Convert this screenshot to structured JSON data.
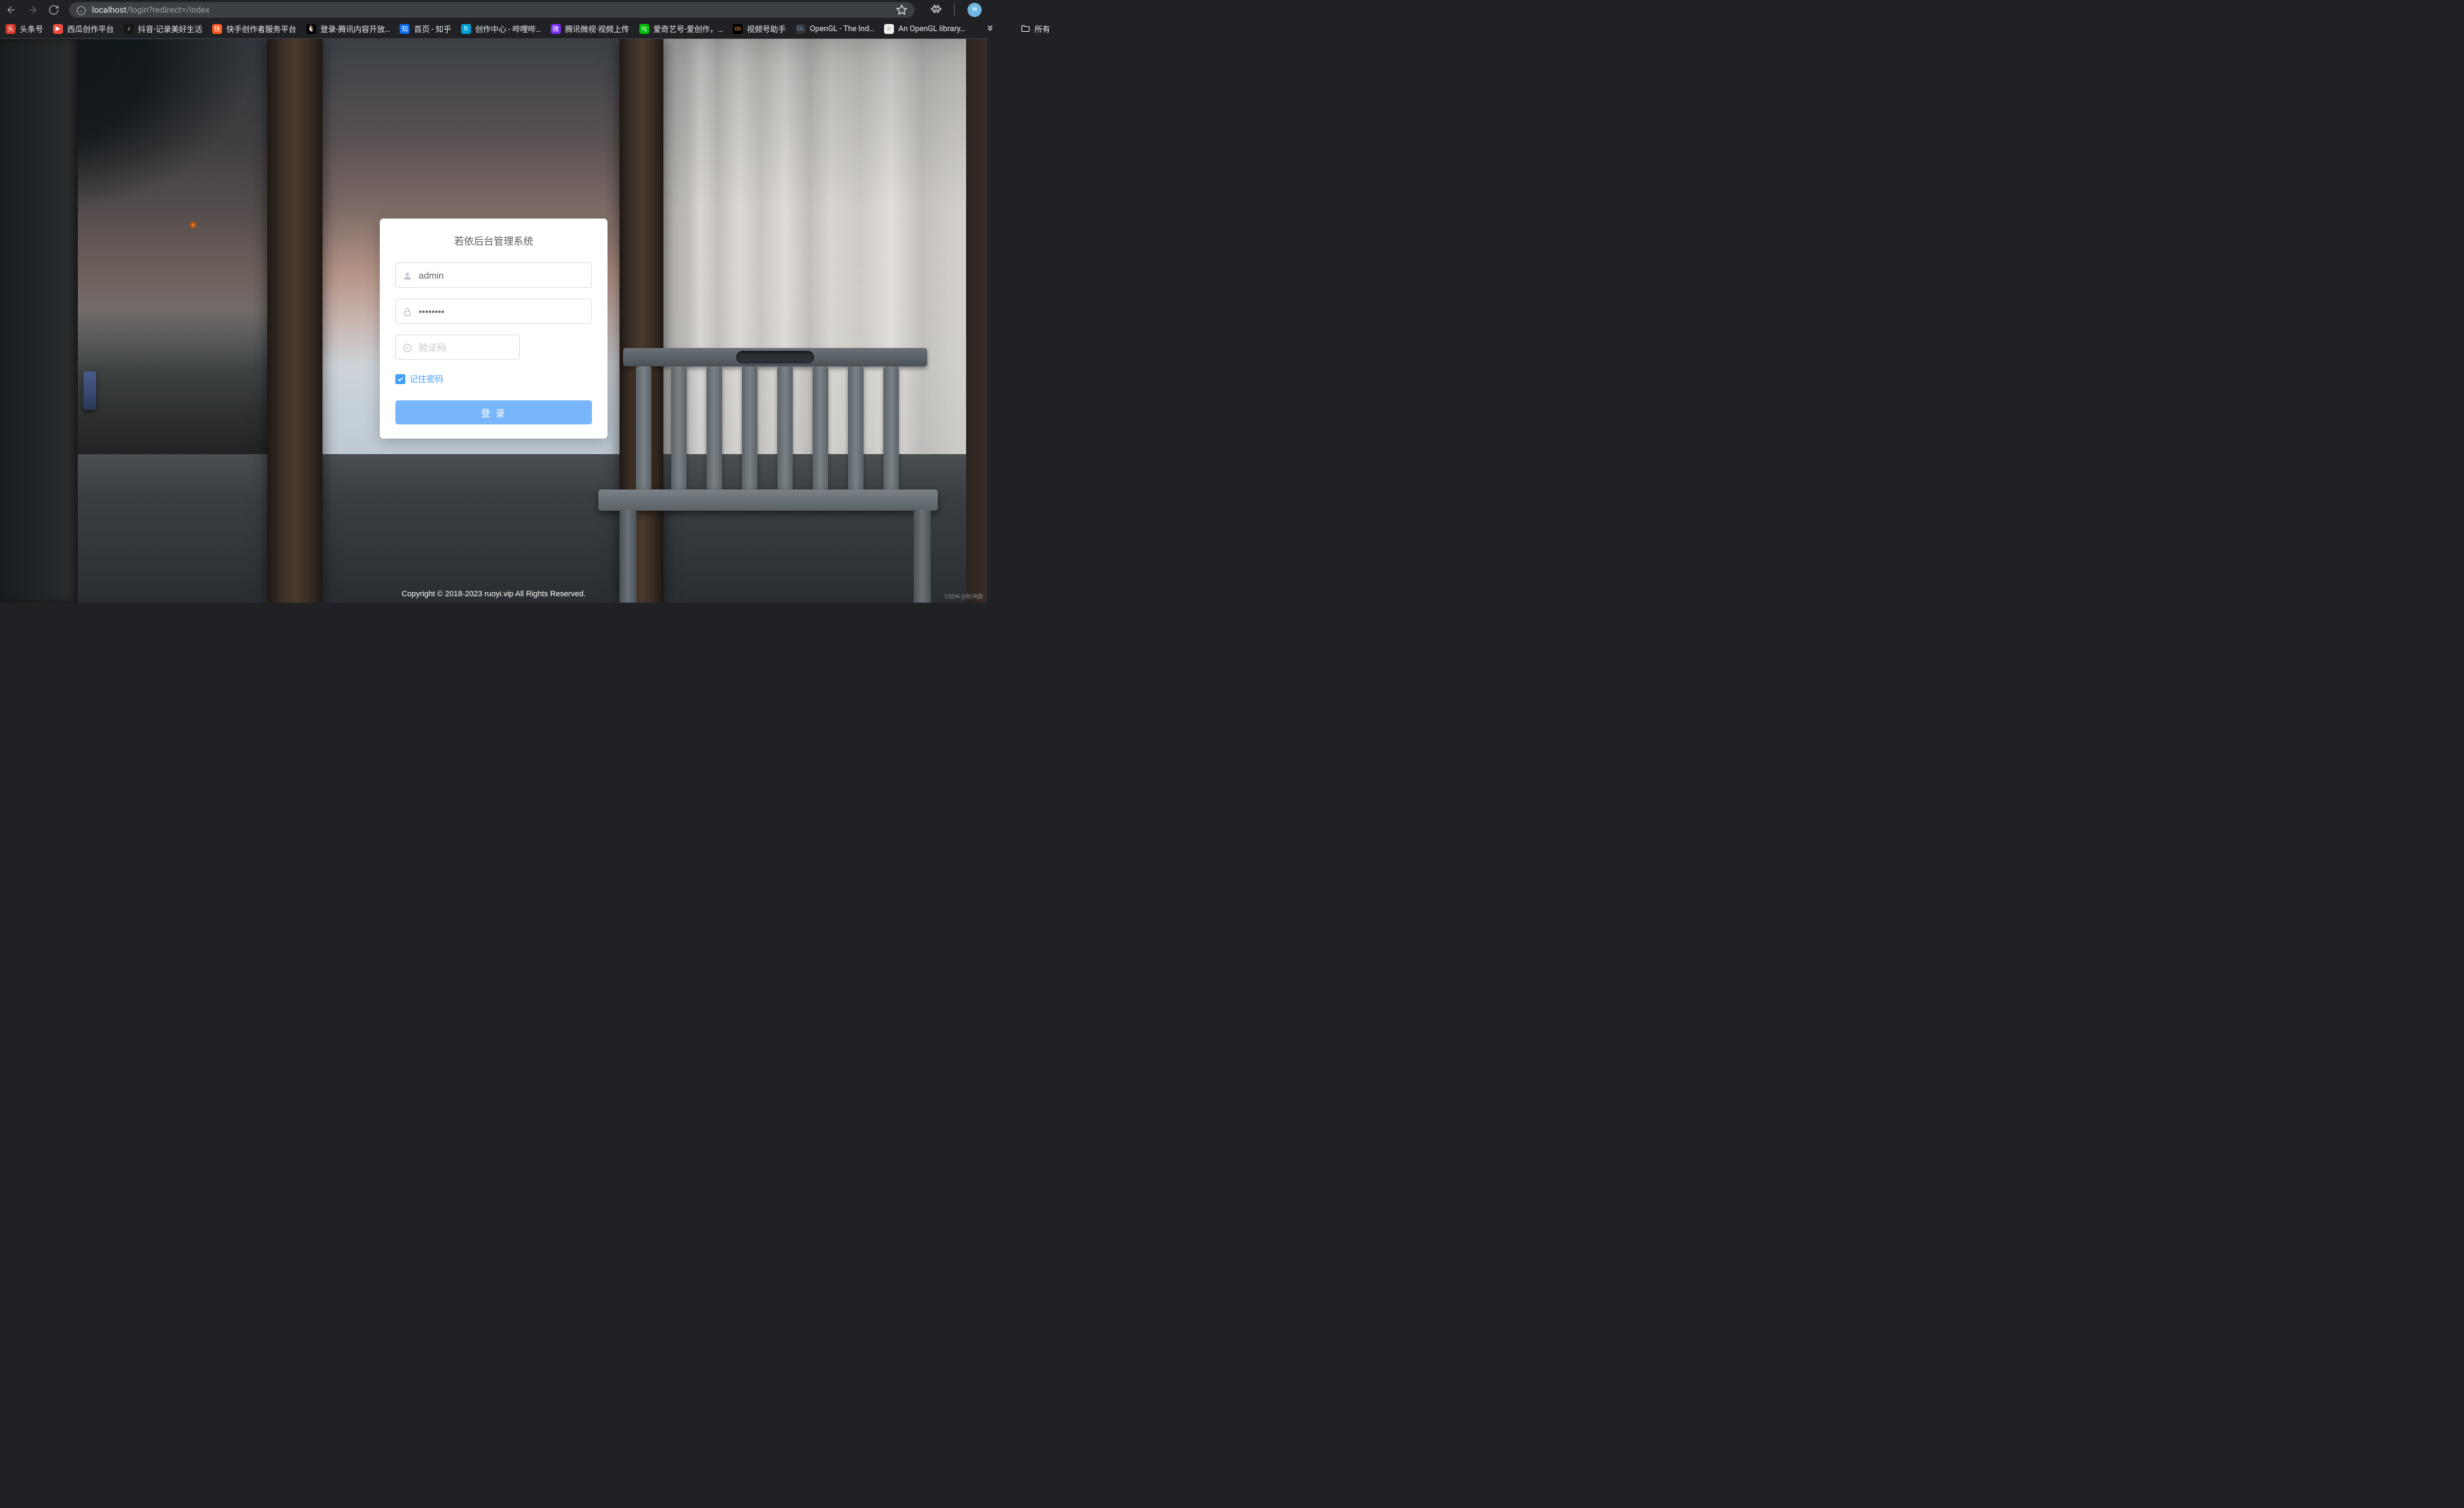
{
  "browser": {
    "url_host": "localhost",
    "url_path": "/login?redirect=/index",
    "profile_initial": "H"
  },
  "bookmarks": {
    "items": [
      {
        "label": "头条号",
        "icon_bg": "#d43c2e",
        "icon_fg": "#fff",
        "icon_txt": "头"
      },
      {
        "label": "西瓜创作平台",
        "icon_bg": "#e84a3c",
        "icon_fg": "#fff",
        "icon_txt": "▶"
      },
      {
        "label": "抖音-记录美好生活",
        "icon_bg": "#161616",
        "icon_fg": "#fff",
        "icon_txt": "♪"
      },
      {
        "label": "快手创作者服务平台",
        "icon_bg": "#ff5722",
        "icon_fg": "#fff",
        "icon_txt": "快"
      },
      {
        "label": "登录-腾讯内容开放…",
        "icon_bg": "#000",
        "icon_fg": "#ffca28",
        "icon_txt": "🐧"
      },
      {
        "label": "首页 - 知乎",
        "icon_bg": "#0d6ef0",
        "icon_fg": "#fff",
        "icon_txt": "知"
      },
      {
        "label": "创作中心 - 哔哩哔…",
        "icon_bg": "#00a1d6",
        "icon_fg": "#fff",
        "icon_txt": "b"
      },
      {
        "label": "腾讯微视·视频上传",
        "icon_bg": "#7b2cff",
        "icon_fg": "#fff",
        "icon_txt": "微"
      },
      {
        "label": "爱奇艺号-爱创作，…",
        "icon_bg": "#00be06",
        "icon_fg": "#fff",
        "icon_txt": "iq"
      },
      {
        "label": "视频号助手",
        "icon_bg": "#000",
        "icon_fg": "#fa9d3b",
        "icon_txt": "∞"
      },
      {
        "label": "OpenGL - The Ind…",
        "icon_bg": "#333",
        "icon_fg": "#6a9bd8",
        "icon_txt": "GL"
      },
      {
        "label": "An OpenGL library…",
        "icon_bg": "#f0f0f0",
        "icon_fg": "#444",
        "icon_txt": "○"
      }
    ],
    "all_label": "所有"
  },
  "login": {
    "title": "若依后台管理系统",
    "username_value": "admin",
    "password_value": "••••••••",
    "captcha_placeholder": "验证码",
    "remember_label": "记住密码",
    "remember_checked": true,
    "submit_label": "登 录"
  },
  "footer": "Copyright © 2018-2023 ruoyi.vip All Rights Reserved.",
  "watermark": "CSDN @秋鸿群"
}
